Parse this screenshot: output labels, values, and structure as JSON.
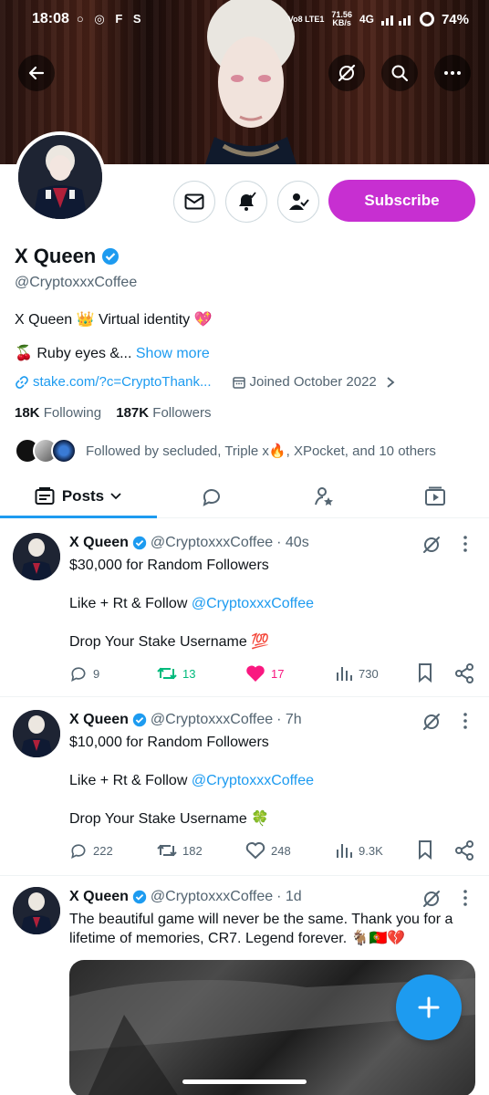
{
  "status_bar": {
    "time": "18:08",
    "left_icons": "○ ◎ F S",
    "network_label": "Vo8 LTE1",
    "speed": "71.56",
    "speed_unit": "KB/s",
    "network_type": "4G",
    "battery": "74%"
  },
  "profile": {
    "name": "X Queen",
    "handle": "@CryptoxxxCoffee",
    "bio_line1": "X Queen 👑 Virtual identity 💖",
    "bio_line2": "🍒 Ruby eyes &...",
    "show_more": "Show more",
    "link": "stake.com/?c=CryptoThank...",
    "joined": "Joined October 2022",
    "following_count": "18K",
    "following_label": "Following",
    "followers_count": "187K",
    "followers_label": "Followers",
    "followed_by": "Followed by secluded, Triple x🔥, XPocket, and 10 others",
    "subscribe_label": "Subscribe"
  },
  "tabs": {
    "posts_label": "Posts"
  },
  "posts": [
    {
      "name": "X Queen",
      "handle": "@CryptoxxxCoffee",
      "time": "· 40s",
      "line1": "$30,000 for Random Followers",
      "line2_prefix": "Like + Rt & Follow ",
      "line2_mention": "@CryptoxxxCoffee",
      "line3": "Drop Your Stake Username 💯",
      "replies": "9",
      "reposts": "13",
      "likes": "17",
      "views": "730"
    },
    {
      "name": "X Queen",
      "handle": "@CryptoxxxCoffee",
      "time": "· 7h",
      "line1": "$10,000 for Random Followers",
      "line2_prefix": "Like + Rt & Follow ",
      "line2_mention": "@CryptoxxxCoffee",
      "line3": "Drop Your Stake Username 🍀",
      "replies": "222",
      "reposts": "182",
      "likes": "248",
      "views": "9.3K"
    },
    {
      "name": "X Queen",
      "handle": "@CryptoxxxCoffee",
      "time": "· 1d",
      "text": "The beautiful game will never be the same. Thank you for a lifetime of memories, CR7. Legend forever. 🐐🇵🇹💔"
    }
  ],
  "colors": {
    "accent": "#1d9bf0",
    "subscribe": "#c72fd1",
    "repost_active": "#00ba7c",
    "like_active": "#f91880"
  }
}
